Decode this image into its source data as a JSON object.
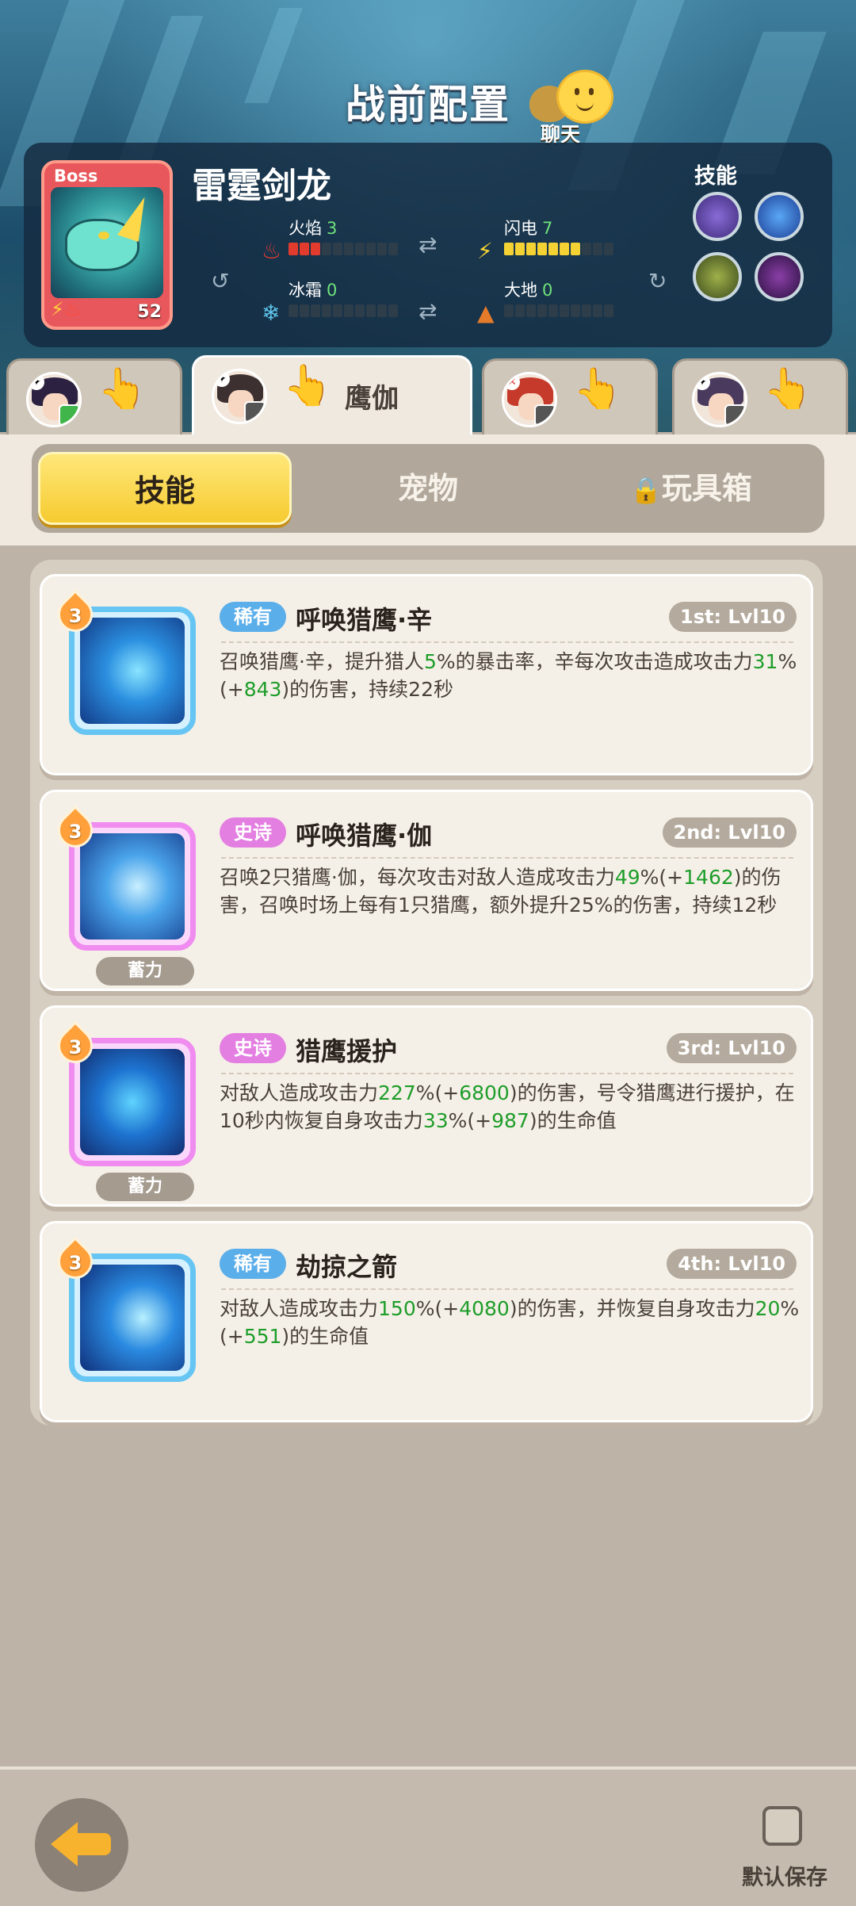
{
  "header": {
    "title": "战前配置",
    "chat_label": "聊天"
  },
  "boss": {
    "tag": "Boss",
    "name": "雷霆剑龙",
    "level": "52",
    "skills_label": "技能",
    "stats": [
      {
        "label": "火焰",
        "value": "3",
        "filled": 3,
        "color": "#e13b2e",
        "icon": "fire-icon"
      },
      {
        "label": "闪电",
        "value": "7",
        "filled": 7,
        "color": "#f5d233",
        "icon": "lightning-icon"
      },
      {
        "label": "冰霜",
        "value": "0",
        "filled": 0,
        "color": "#5ec3ea",
        "icon": "snowflake-icon"
      },
      {
        "label": "大地",
        "value": "0",
        "filled": 0,
        "color": "#e47b2a",
        "icon": "earth-icon"
      }
    ]
  },
  "hero_tabs": [
    {
      "name": "",
      "active": false
    },
    {
      "name": "鹰伽",
      "active": true
    },
    {
      "name": "",
      "active": false
    },
    {
      "name": "",
      "active": false
    }
  ],
  "tabs": {
    "skills": "技能",
    "pets": "宠物",
    "toybox": "玩具箱"
  },
  "skills": [
    {
      "rarity": "稀有",
      "rarity_type": "rare",
      "name": "呼唤猎鹰·辛",
      "level": "1st: Lvl10",
      "stars": "3",
      "charge": "",
      "desc": [
        {
          "t": "召唤猎鹰·辛，提升猎人"
        },
        {
          "t": "5",
          "g": true
        },
        {
          "t": "%的暴击率，辛每次攻击造成攻击力"
        },
        {
          "t": "31",
          "g": true
        },
        {
          "t": "%(+"
        },
        {
          "t": "843",
          "g": true
        },
        {
          "t": ")的伤害，持续22秒"
        }
      ]
    },
    {
      "rarity": "史诗",
      "rarity_type": "epic",
      "name": "呼唤猎鹰·伽",
      "level": "2nd: Lvl10",
      "stars": "3",
      "charge": "蓄力",
      "desc": [
        {
          "t": "召唤2只猎鹰·伽，每次攻击对敌人造成攻击力"
        },
        {
          "t": "49",
          "g": true
        },
        {
          "t": "%(+"
        },
        {
          "t": "1462",
          "g": true
        },
        {
          "t": ")的伤害，召唤时场上每有1只猎鹰，额外提升25%的伤害，持续12秒"
        }
      ]
    },
    {
      "rarity": "史诗",
      "rarity_type": "epic",
      "name": "猎鹰援护",
      "level": "3rd: Lvl10",
      "stars": "3",
      "charge": "蓄力",
      "desc": [
        {
          "t": "对敌人造成攻击力"
        },
        {
          "t": "227",
          "g": true
        },
        {
          "t": "%(+"
        },
        {
          "t": "6800",
          "g": true
        },
        {
          "t": ")的伤害，号令猎鹰进行援护，在10秒内恢复自身攻击力"
        },
        {
          "t": "33",
          "g": true
        },
        {
          "t": "%(+"
        },
        {
          "t": "987",
          "g": true
        },
        {
          "t": ")的生命值"
        }
      ]
    },
    {
      "rarity": "稀有",
      "rarity_type": "rare",
      "name": "劫掠之箭",
      "level": "4th: Lvl10",
      "stars": "3",
      "charge": "",
      "desc": [
        {
          "t": "对敌人造成攻击力"
        },
        {
          "t": "150",
          "g": true
        },
        {
          "t": "%(+"
        },
        {
          "t": "4080",
          "g": true
        },
        {
          "t": ")的伤害，并恢复自身攻击力"
        },
        {
          "t": "20",
          "g": true
        },
        {
          "t": "%(+"
        },
        {
          "t": "551",
          "g": true
        },
        {
          "t": ")的生命值"
        }
      ]
    }
  ],
  "footer": {
    "default_save_label": "默认保存",
    "default_save_checked": false
  }
}
